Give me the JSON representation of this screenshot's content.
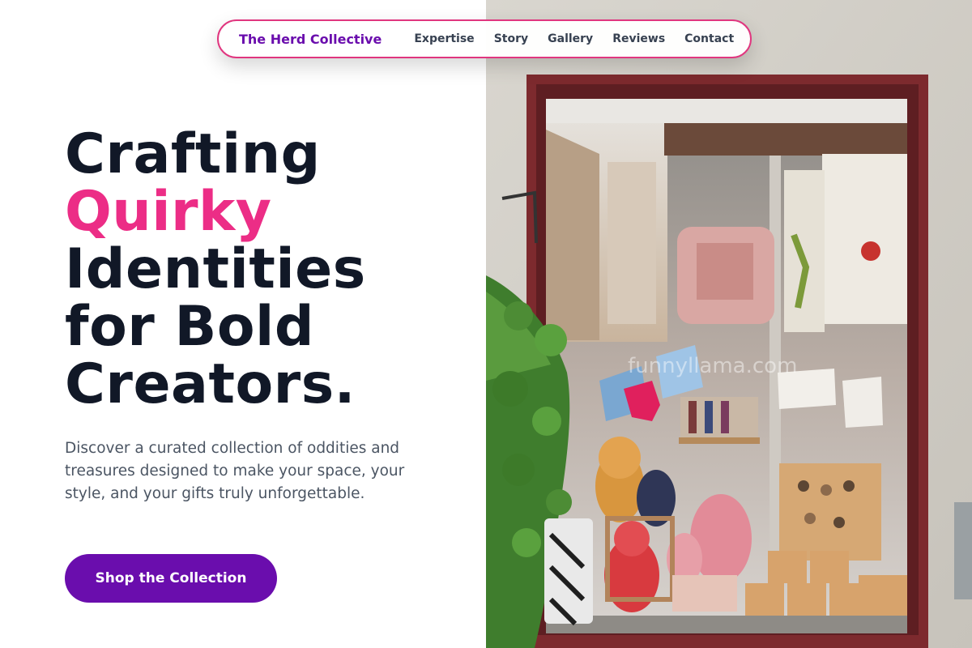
{
  "nav": {
    "brand": "The Herd Collective",
    "links": [
      "Expertise",
      "Story",
      "Gallery",
      "Reviews",
      "Contact"
    ]
  },
  "hero": {
    "title_line1": "Crafting",
    "title_accent": "Quirky",
    "title_line3": "Identities",
    "title_line4": "for Bold",
    "title_line5": "Creators.",
    "description": "Discover a curated collection of oddities and treasures designed to make your space, your style, and your gifts truly unforgettable.",
    "cta_label": "Shop the Collection"
  },
  "photo": {
    "watermark": "funnyllama.com"
  },
  "colors": {
    "brand_purple": "#6a0dad",
    "accent_pink": "#ec2d86",
    "nav_border": "#e0367f",
    "heading": "#111827",
    "body_text": "#4b5563"
  }
}
